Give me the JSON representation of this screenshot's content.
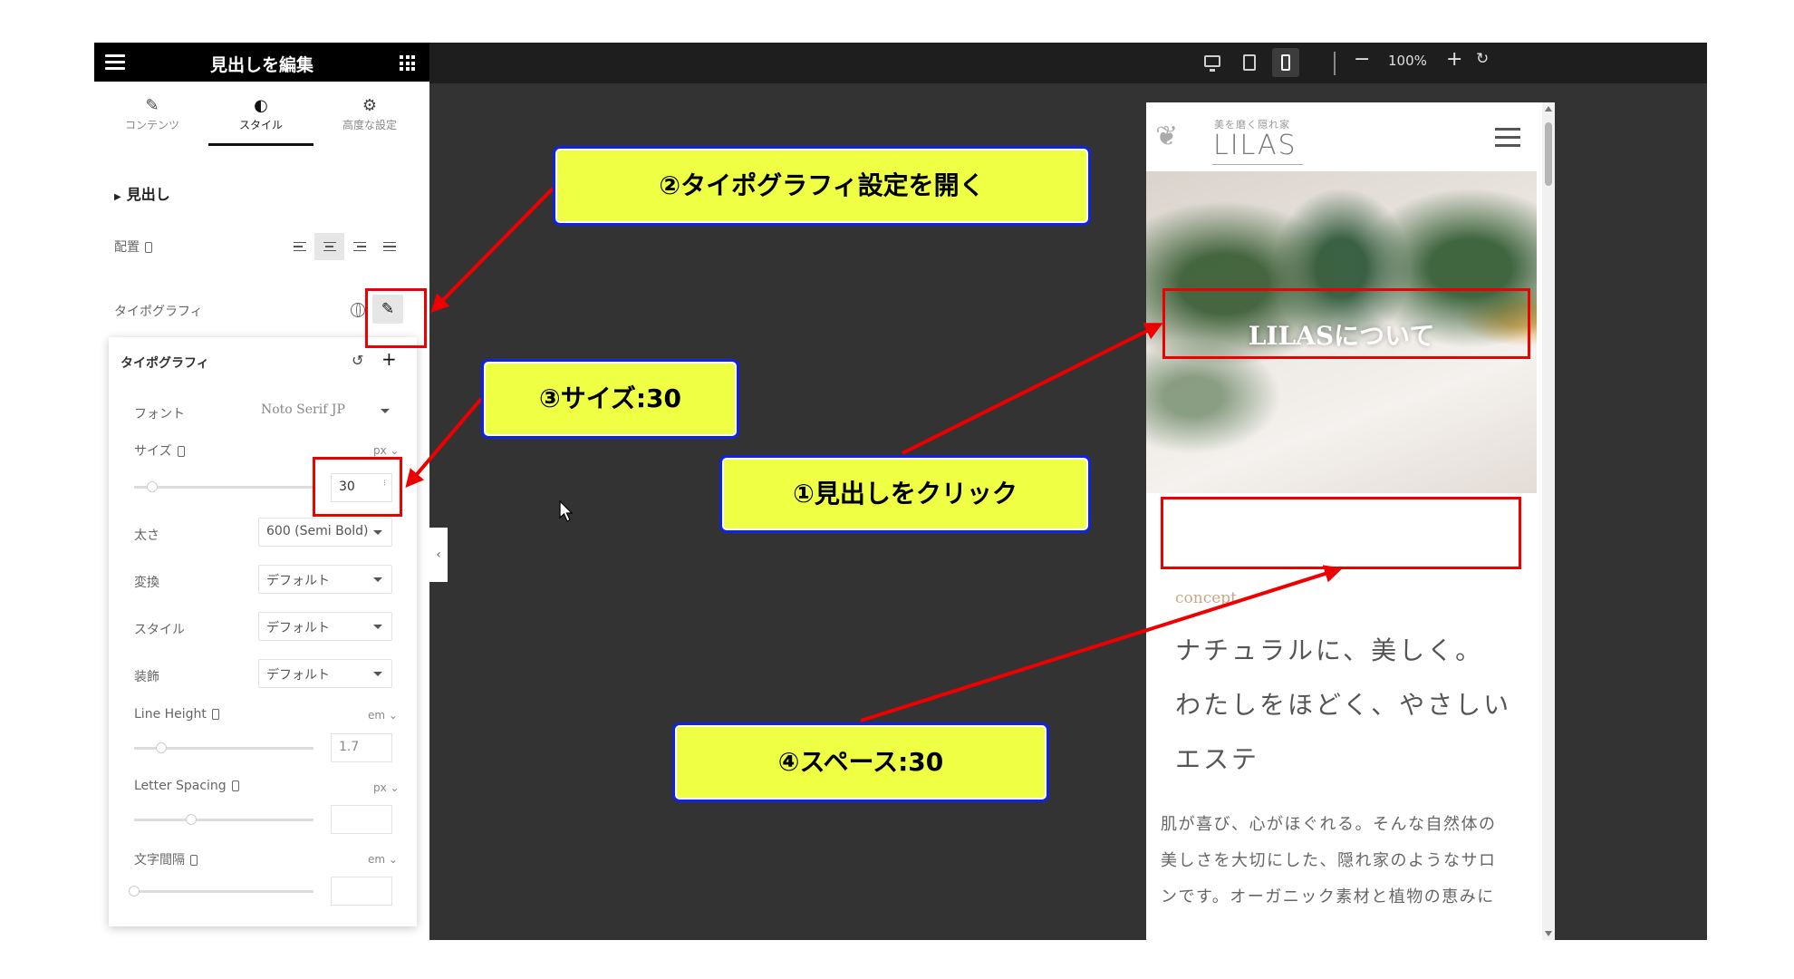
{
  "panel": {
    "title": "見出しを編集",
    "tabs": [
      {
        "label": "コンテンツ",
        "icon": "pencil-icon"
      },
      {
        "label": "スタイル",
        "icon": "contrast-icon"
      },
      {
        "label": "高度な設定",
        "icon": "gear-icon"
      }
    ],
    "section_label": "見出し",
    "align_label": "配置",
    "typography_label": "タイポグラフィ"
  },
  "typography": {
    "title": "タイポグラフィ",
    "font_label": "フォント",
    "font_value": "Noto Serif JP",
    "size_label": "サイズ",
    "size_unit": "px",
    "size_value": "30",
    "size_fraction": 0.1,
    "weight_label": "太さ",
    "weight_value": "600 (Semi Bold)",
    "transform_label": "変換",
    "transform_value": "デフォルト",
    "style_label": "スタイル",
    "style_value": "デフォルト",
    "decoration_label": "装飾",
    "decoration_value": "デフォルト",
    "line_height_label": "Line Height",
    "line_height_unit": "em",
    "line_height_placeholder": "1.7",
    "letter_spacing_label": "Letter Spacing",
    "letter_spacing_unit": "px",
    "word_spacing_label": "文字間隔",
    "word_spacing_unit": "em"
  },
  "toolbar": {
    "zoom": "100%",
    "minus": "−",
    "plus": "+"
  },
  "preview": {
    "logo_sub": "美を磨く隠れ家",
    "logo": "LILAS",
    "hero_heading": "LILASについて",
    "concept": "concept",
    "lead_lines": [
      "ナチュラルに、美しく。",
      "わたしをほどく、やさしい",
      "エステ"
    ],
    "body_lines": [
      "肌が喜び、心がほぐれる。そんな自然体の",
      "美しさを大切にした、隠れ家のようなサロ",
      "ンです。オーガニック素材と植物の恵みに"
    ]
  },
  "annotations": {
    "step1": "①見出しをクリック",
    "step2": "②タイポグラフィ設定を開く",
    "step3": "③サイズ:30",
    "step4": "④スペース:30"
  },
  "colors": {
    "callout_fill": "#eeff44",
    "callout_border": "#1022e8",
    "highlight_red": "#ee0000"
  }
}
